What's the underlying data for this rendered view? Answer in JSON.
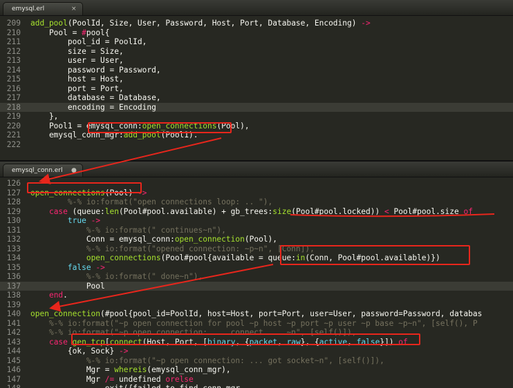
{
  "tabs": {
    "top": {
      "name": "emysql.erl",
      "control": "×"
    },
    "bottom": {
      "name": "emysql_conn.erl",
      "control": "●"
    }
  },
  "pane1_lines": [
    {
      "n": "209",
      "parts": [
        [
          "f",
          "add_pool"
        ],
        [
          "",
          "(PoolId, Size, User, Password, Host, Port, Database, Encoding) "
        ],
        [
          "k",
          "->"
        ]
      ]
    },
    {
      "n": "210",
      "parts": [
        [
          "",
          "    Pool = "
        ],
        [
          "k",
          "#"
        ],
        [
          "",
          "pool{"
        ]
      ]
    },
    {
      "n": "211",
      "parts": [
        [
          "",
          "        pool_id = PoolId,"
        ]
      ]
    },
    {
      "n": "212",
      "parts": [
        [
          "",
          "        size = Size,"
        ]
      ]
    },
    {
      "n": "213",
      "parts": [
        [
          "",
          "        user = User,"
        ]
      ]
    },
    {
      "n": "214",
      "parts": [
        [
          "",
          "        password = Password,"
        ]
      ]
    },
    {
      "n": "215",
      "parts": [
        [
          "",
          "        host = Host,"
        ]
      ]
    },
    {
      "n": "216",
      "parts": [
        [
          "",
          "        port = Port,"
        ]
      ]
    },
    {
      "n": "217",
      "parts": [
        [
          "",
          "        database = Database,"
        ]
      ]
    },
    {
      "n": "218",
      "cur": true,
      "parts": [
        [
          "",
          "        encoding = Encoding"
        ]
      ]
    },
    {
      "n": "219",
      "parts": [
        [
          "",
          "    },"
        ]
      ]
    },
    {
      "n": "220",
      "parts": [
        [
          "",
          "    Pool1 = emysql_conn:"
        ],
        [
          "f",
          "open_connections"
        ],
        [
          "",
          "(Pool),"
        ]
      ]
    },
    {
      "n": "221",
      "parts": [
        [
          "",
          "    emysql_conn_mgr:"
        ],
        [
          "f",
          "add_pool"
        ],
        [
          "",
          "(Pool1)."
        ]
      ]
    },
    {
      "n": "222",
      "parts": [
        [
          "",
          ""
        ]
      ]
    }
  ],
  "pane2_lines": [
    {
      "n": "126",
      "parts": [
        [
          "",
          ""
        ]
      ]
    },
    {
      "n": "127",
      "parts": [
        [
          "f",
          "open_connections"
        ],
        [
          "",
          "(Pool) "
        ],
        [
          "k",
          "->"
        ]
      ]
    },
    {
      "n": "128",
      "parts": [
        [
          "c",
          "        %-% io:format(\"open connections loop: .. \"),"
        ]
      ]
    },
    {
      "n": "129",
      "parts": [
        [
          "",
          "    "
        ],
        [
          "k",
          "case"
        ],
        [
          "",
          " (queue:"
        ],
        [
          "f",
          "len"
        ],
        [
          "",
          "(Pool#pool.available) + gb_trees:"
        ],
        [
          "f",
          "size"
        ],
        [
          "",
          "(Pool#pool.locked)) "
        ],
        [
          "k",
          "<"
        ],
        [
          "",
          " Pool#pool.size "
        ],
        [
          "k",
          "of"
        ]
      ]
    },
    {
      "n": "130",
      "parts": [
        [
          "",
          "        "
        ],
        [
          "p",
          "true"
        ],
        [
          "",
          " "
        ],
        [
          "k",
          "->"
        ]
      ]
    },
    {
      "n": "131",
      "parts": [
        [
          "c",
          "            %-% io:format(\" continues~n\"),"
        ]
      ]
    },
    {
      "n": "132",
      "parts": [
        [
          "",
          "            Conn = emysql_conn:"
        ],
        [
          "f",
          "open_connection"
        ],
        [
          "",
          "(Pool),"
        ]
      ]
    },
    {
      "n": "133",
      "parts": [
        [
          "c",
          "            %-% io:format(\"opened connection: ~p~n\", [Conn]),"
        ]
      ]
    },
    {
      "n": "134",
      "parts": [
        [
          "",
          "            "
        ],
        [
          "f",
          "open_connections"
        ],
        [
          "",
          "(Pool#pool{available = queue:"
        ],
        [
          "f",
          "in"
        ],
        [
          "",
          "(Conn, Pool#pool.available)})"
        ]
      ]
    },
    {
      "n": "135",
      "parts": [
        [
          "",
          "        "
        ],
        [
          "p",
          "false"
        ],
        [
          "",
          " "
        ],
        [
          "k",
          "->"
        ]
      ]
    },
    {
      "n": "136",
      "parts": [
        [
          "c",
          "            %-% io:format(\" done~n\"),"
        ]
      ]
    },
    {
      "n": "137",
      "cur": true,
      "parts": [
        [
          "",
          "            Pool"
        ]
      ]
    },
    {
      "n": "138",
      "parts": [
        [
          "",
          "    "
        ],
        [
          "k",
          "end"
        ],
        [
          "",
          "."
        ]
      ]
    },
    {
      "n": "139",
      "parts": [
        [
          "",
          ""
        ]
      ]
    },
    {
      "n": "140",
      "parts": [
        [
          "f",
          "open_connection"
        ],
        [
          "",
          "(#pool{pool_id=PoolId, host=Host, port=Port, user=User, password=Password, databas"
        ]
      ]
    },
    {
      "n": "141",
      "parts": [
        [
          "c",
          "    %-% io:format(\"~p open connection for pool ~p host ~p port ~p user ~p base ~p~n\", [self(), P"
        ]
      ]
    },
    {
      "n": "142",
      "parts": [
        [
          "c",
          "    %-% io:format(\"~p open connection: ... connect ... ~n\", [self()]),"
        ]
      ]
    },
    {
      "n": "143",
      "parts": [
        [
          "",
          "    "
        ],
        [
          "k",
          "case"
        ],
        [
          "",
          " "
        ],
        [
          "f",
          "gen_tcp"
        ],
        [
          "",
          "["
        ],
        [
          "f",
          "connect"
        ],
        [
          "",
          "(Host, Port, ["
        ],
        [
          "p",
          "binary"
        ],
        [
          "",
          ", {"
        ],
        [
          "p",
          "packet"
        ],
        [
          "",
          ", "
        ],
        [
          "p",
          "raw"
        ],
        [
          "",
          "}, {"
        ],
        [
          "p",
          "active"
        ],
        [
          "",
          ", "
        ],
        [
          "p",
          "false"
        ],
        [
          "",
          "}]) "
        ],
        [
          "k",
          "of"
        ]
      ]
    },
    {
      "n": "144",
      "parts": [
        [
          "",
          "        {ok, Sock} "
        ],
        [
          "k",
          "->"
        ]
      ]
    },
    {
      "n": "145",
      "parts": [
        [
          "c",
          "            %-% io:format(\"~p open connection: ... got socket~n\", [self()]),"
        ]
      ]
    },
    {
      "n": "146",
      "parts": [
        [
          "",
          "            Mgr = "
        ],
        [
          "f",
          "whereis"
        ],
        [
          "",
          "(emysql_conn_mgr),"
        ]
      ]
    },
    {
      "n": "147",
      "parts": [
        [
          "",
          "            Mgr "
        ],
        [
          "k",
          "/="
        ],
        [
          "",
          " undefined "
        ],
        [
          "k",
          "orelse"
        ]
      ]
    },
    {
      "n": "148",
      "parts": [
        [
          "",
          "                exit({failed_to_find_conn_mgr,"
        ]
      ]
    }
  ]
}
